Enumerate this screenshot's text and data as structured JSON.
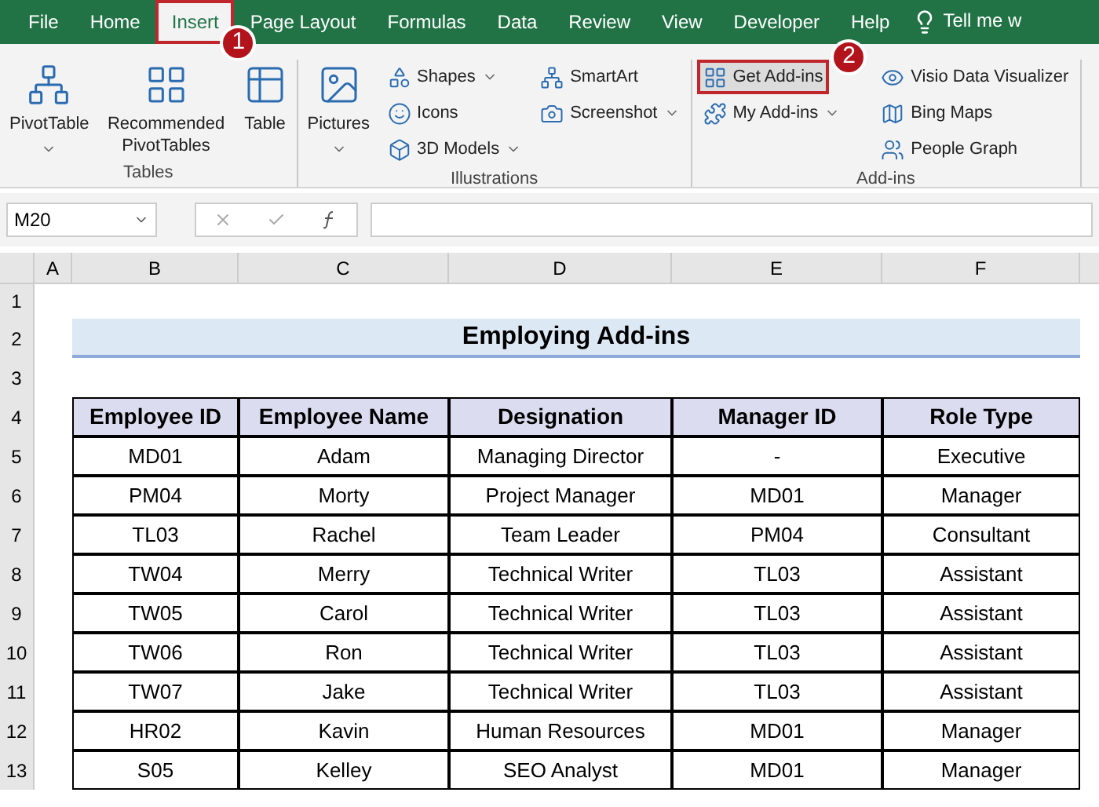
{
  "tabs": [
    {
      "label": "File",
      "selected": false,
      "highlighted": false
    },
    {
      "label": "Home",
      "selected": false,
      "highlighted": false
    },
    {
      "label": "Insert",
      "selected": true,
      "highlighted": true
    },
    {
      "label": "Page Layout",
      "selected": false,
      "highlighted": false
    },
    {
      "label": "Formulas",
      "selected": false,
      "highlighted": false
    },
    {
      "label": "Data",
      "selected": false,
      "highlighted": false
    },
    {
      "label": "Review",
      "selected": false,
      "highlighted": false
    },
    {
      "label": "View",
      "selected": false,
      "highlighted": false
    },
    {
      "label": "Developer",
      "selected": false,
      "highlighted": false
    },
    {
      "label": "Help",
      "selected": false,
      "highlighted": false
    }
  ],
  "tell_me": "Tell me w",
  "ribbon_groups": [
    {
      "label": "Tables",
      "columns": [
        {
          "kind": "large",
          "items": [
            {
              "label": "PivotTable",
              "dropdown": true,
              "highlighted": false
            }
          ]
        },
        {
          "kind": "large",
          "items": [
            {
              "label": "Recommended PivotTables",
              "dropdown": false,
              "highlighted": false
            }
          ]
        },
        {
          "kind": "large",
          "items": [
            {
              "label": "Table",
              "dropdown": false,
              "highlighted": false
            }
          ]
        }
      ]
    },
    {
      "label": "Illustrations",
      "columns": [
        {
          "kind": "large",
          "items": [
            {
              "label": "Pictures",
              "dropdown": true,
              "highlighted": false
            }
          ]
        },
        {
          "kind": "small",
          "items": [
            {
              "label": "Shapes",
              "dropdown": true,
              "highlighted": false
            },
            {
              "label": "Icons",
              "dropdown": false,
              "highlighted": false
            },
            {
              "label": "3D Models",
              "dropdown": true,
              "highlighted": false
            }
          ]
        },
        {
          "kind": "small",
          "items": [
            {
              "label": "SmartArt",
              "dropdown": false,
              "highlighted": false
            },
            {
              "label": "Screenshot",
              "dropdown": true,
              "highlighted": false
            }
          ]
        }
      ]
    },
    {
      "label": "Add-ins",
      "columns": [
        {
          "kind": "small",
          "items": [
            {
              "label": "Get Add-ins",
              "dropdown": false,
              "highlighted": true
            },
            {
              "label": "My Add-ins",
              "dropdown": true,
              "highlighted": false
            }
          ]
        },
        {
          "kind": "small",
          "items": [
            {
              "label": "Visio Data Visualizer",
              "dropdown": false,
              "highlighted": false
            },
            {
              "label": "Bing Maps",
              "dropdown": false,
              "highlighted": false
            },
            {
              "label": "People Graph",
              "dropdown": false,
              "highlighted": false
            }
          ]
        }
      ]
    }
  ],
  "callouts": [
    "1",
    "2"
  ],
  "name_box": "M20",
  "column_headers": [
    "A",
    "B",
    "C",
    "D",
    "E",
    "F"
  ],
  "row_numbers": [
    "1",
    "2",
    "3",
    "4",
    "5",
    "6",
    "7",
    "8",
    "9",
    "10",
    "11",
    "12",
    "13"
  ],
  "title": "Employing Add-ins",
  "table": {
    "columns": [
      "Employee ID",
      "Employee Name",
      "Designation",
      "Manager ID",
      "Role Type"
    ],
    "rows": [
      [
        "MD01",
        "Adam",
        "Managing Director",
        "-",
        "Executive"
      ],
      [
        "PM04",
        "Morty",
        "Project Manager",
        "MD01",
        "Manager"
      ],
      [
        "TL03",
        "Rachel",
        "Team Leader",
        "PM04",
        "Consultant"
      ],
      [
        "TW04",
        "Merry",
        "Technical Writer",
        "TL03",
        "Assistant"
      ],
      [
        "TW05",
        "Carol",
        "Technical Writer",
        "TL03",
        "Assistant"
      ],
      [
        "TW06",
        "Ron",
        "Technical Writer",
        "TL03",
        "Assistant"
      ],
      [
        "TW07",
        "Jake",
        "Technical Writer",
        "TL03",
        "Assistant"
      ],
      [
        "HR02",
        "Kavin",
        "Human Resources",
        "MD01",
        "Manager"
      ],
      [
        "S05",
        "Kelley",
        "SEO Analyst",
        "MD01",
        "Manager"
      ]
    ]
  }
}
